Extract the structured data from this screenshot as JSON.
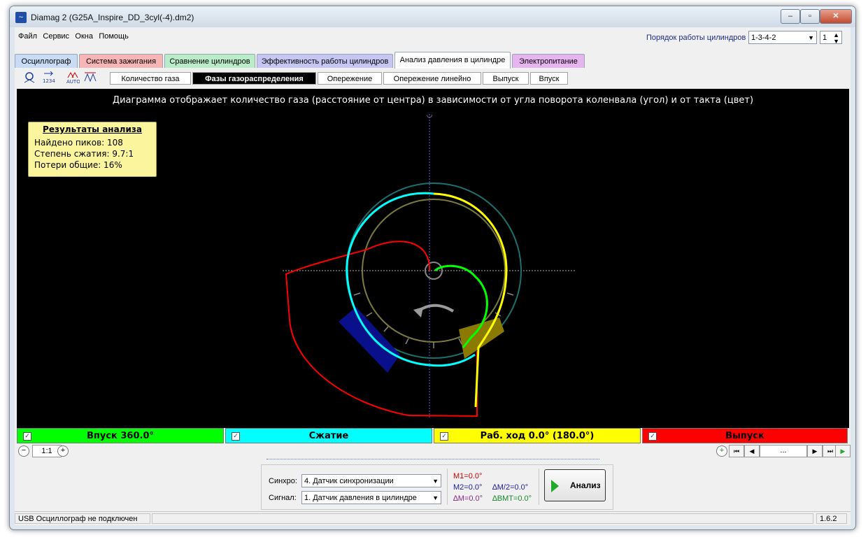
{
  "window": {
    "title": "Diamag 2 (G25A_Inspire_DD_3cyl(-4).dm2)",
    "controls": [
      "minimize",
      "maximize",
      "close"
    ]
  },
  "menu": [
    "Файл",
    "Сервис",
    "Окна",
    "Помощь"
  ],
  "cylinder_order": {
    "label": "Порядок работы цилиндров",
    "value": "1-3-4-2",
    "number": "1"
  },
  "main_tabs": [
    {
      "label": "Осциллограф",
      "color": "#c9dcf5"
    },
    {
      "label": "Система зажигания",
      "color": "#f7b5b5"
    },
    {
      "label": "Сравнение цилиндров",
      "color": "#b9ecc9"
    },
    {
      "label": "Эффективность работы цилиндров",
      "color": "#c6c6f5"
    },
    {
      "label": "Анализ давления в цилиндре",
      "color": "#ffffff"
    },
    {
      "label": "Электропитание",
      "color": "#e6b5f0"
    }
  ],
  "toolbar_icons": [
    "network-icon",
    "counter-1234-icon",
    "auto-icon",
    "waveform-icon"
  ],
  "sub_tabs": [
    "Количество газа",
    "Фазы газораспределения",
    "Опережение",
    "Опережение линейно",
    "Выпуск",
    "Впуск"
  ],
  "diagram": {
    "caption": "Диаграмма отображает количество газа (расстояние от центра) в зависимости от угла поворота коленвала (угол) и от такта (цвет)",
    "colors": {
      "intake": "#00ff00",
      "compression": "#00ffff",
      "work": "#ffff00",
      "exhaust": "#ff0000"
    }
  },
  "results": {
    "title": "Результаты анализа",
    "rows": [
      "Найдено пиков: 108",
      "Степень сжатия: 9.7:1",
      "Потери общие: 16%"
    ]
  },
  "legend": [
    {
      "label": "Впуск 360.0°",
      "color": "#00ff00",
      "checked": true
    },
    {
      "label": "Сжатие",
      "color": "#00ffff",
      "checked": true
    },
    {
      "label": "Раб. ход 0.0° (180.0°)",
      "color": "#ffff00",
      "checked": true
    },
    {
      "label": "Выпуск",
      "color": "#ff0000",
      "checked": true
    }
  ],
  "zoom": {
    "value": "1:1"
  },
  "nav": {
    "ellipsis": "..."
  },
  "controls": {
    "sync_label": "Синхро:",
    "sync_value": "4.  Датчик синхронизации",
    "signal_label": "Сигнал:",
    "signal_value": "1.  Датчик давления в цилиндре",
    "m1": "M1=0.0°",
    "m2": "M2=0.0°",
    "dm": "∆M=0.0°",
    "dm2": "∆M/2=0.0°",
    "dbmt": "∆BMT=0.0°",
    "analyze": "Анализ"
  },
  "status": {
    "left": "USB Осциллограф не подключен",
    "version": "1.6.2"
  }
}
